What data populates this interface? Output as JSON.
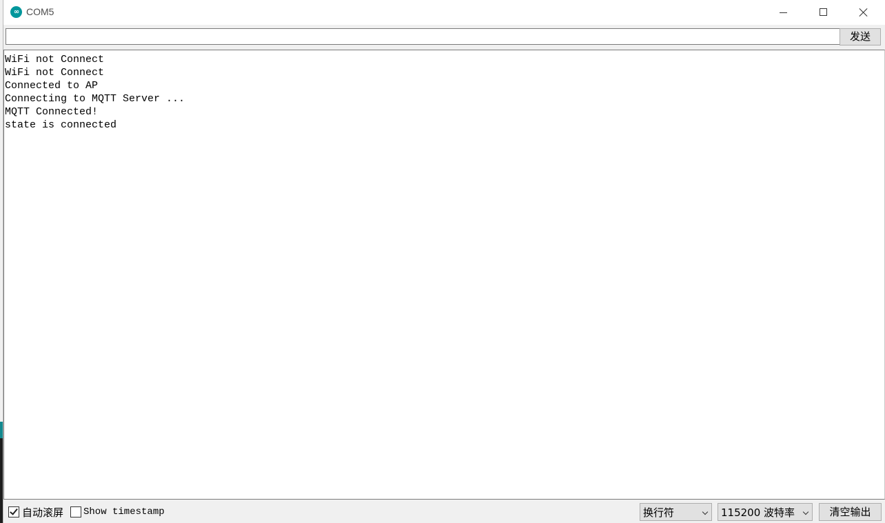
{
  "window": {
    "title": "COM5",
    "app_icon": "arduino-icon",
    "controls": [
      "minimize-icon",
      "maximize-icon",
      "close-icon"
    ]
  },
  "send": {
    "input_value": "",
    "button_label": "发送"
  },
  "output": {
    "lines": [
      "WiFi not Connect",
      "WiFi not Connect",
      "Connected to AP",
      "Connecting to MQTT Server ...",
      "MQTT Connected!",
      "state is connected"
    ]
  },
  "footer": {
    "autoscroll": {
      "label": "自动滚屏",
      "checked": true
    },
    "timestamp": {
      "label": "Show timestamp",
      "checked": false
    },
    "line_ending": {
      "selected": "换行符"
    },
    "baud_rate": {
      "selected": "115200 波特率"
    },
    "clear_button_label": "清空输出"
  },
  "colors": {
    "accent": "#00979c",
    "chrome": "#f0f0f0",
    "button": "#e1e1e1"
  }
}
